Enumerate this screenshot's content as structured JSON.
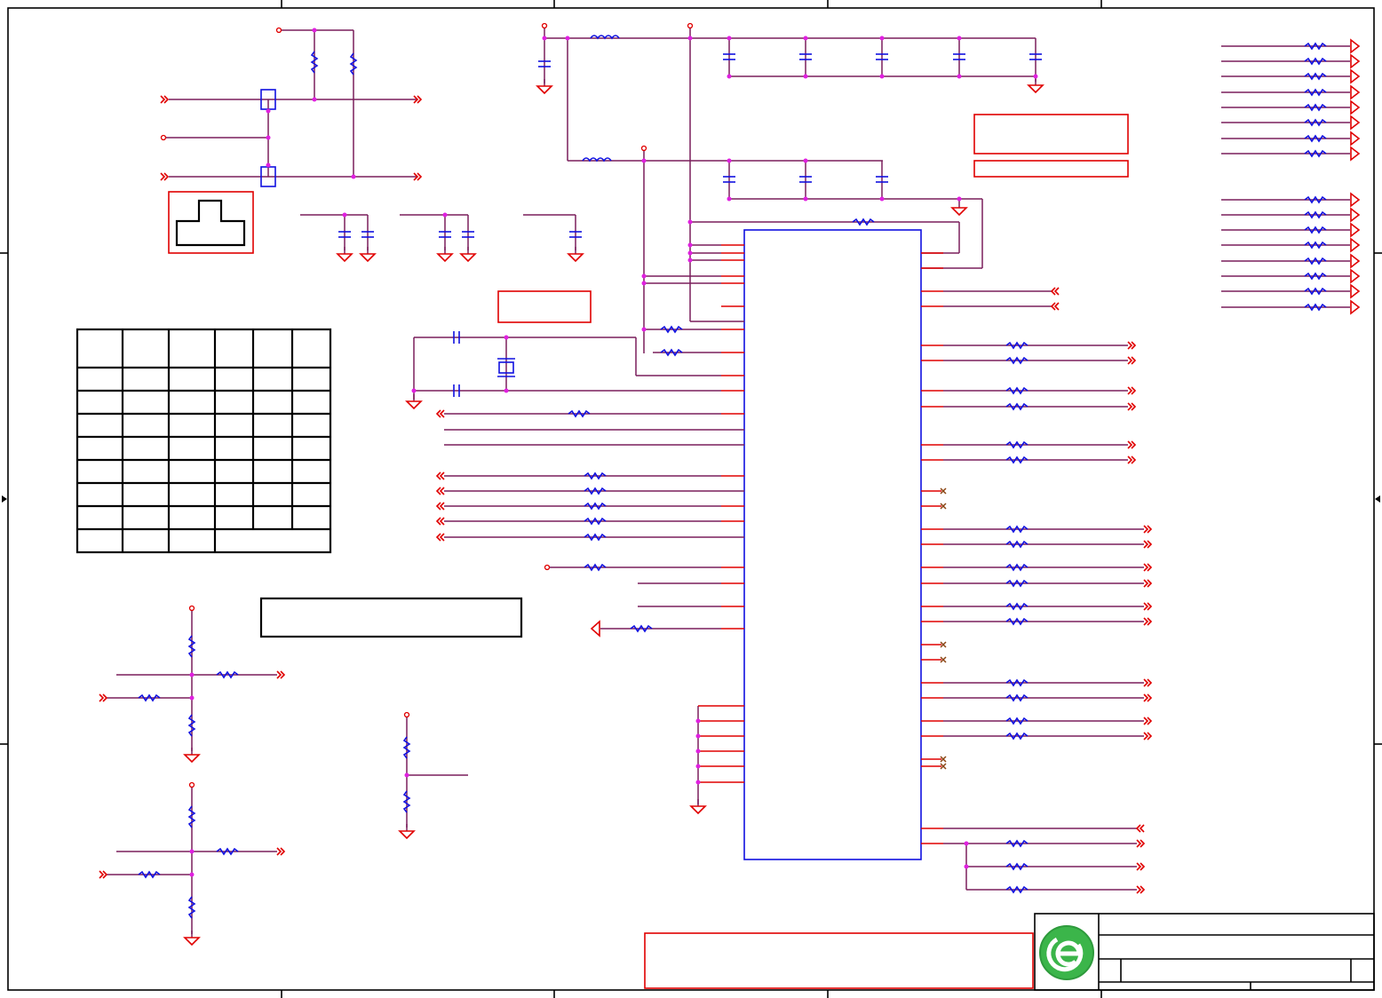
{
  "diagram": {
    "kind": "electrical-schematic",
    "colors": {
      "wire": "#7a1f5c",
      "pin": "#e00000",
      "component": "#1010e0",
      "junction": "#e020e0",
      "frame": "#000000",
      "no_connect": "#8b4513",
      "logo_green": "#3bb54a"
    },
    "text": [],
    "icons": [
      "company-logo-icon",
      "ground-symbol-icon",
      "power-port-icon",
      "off-page-connector-icon",
      "no-connect-icon"
    ]
  }
}
